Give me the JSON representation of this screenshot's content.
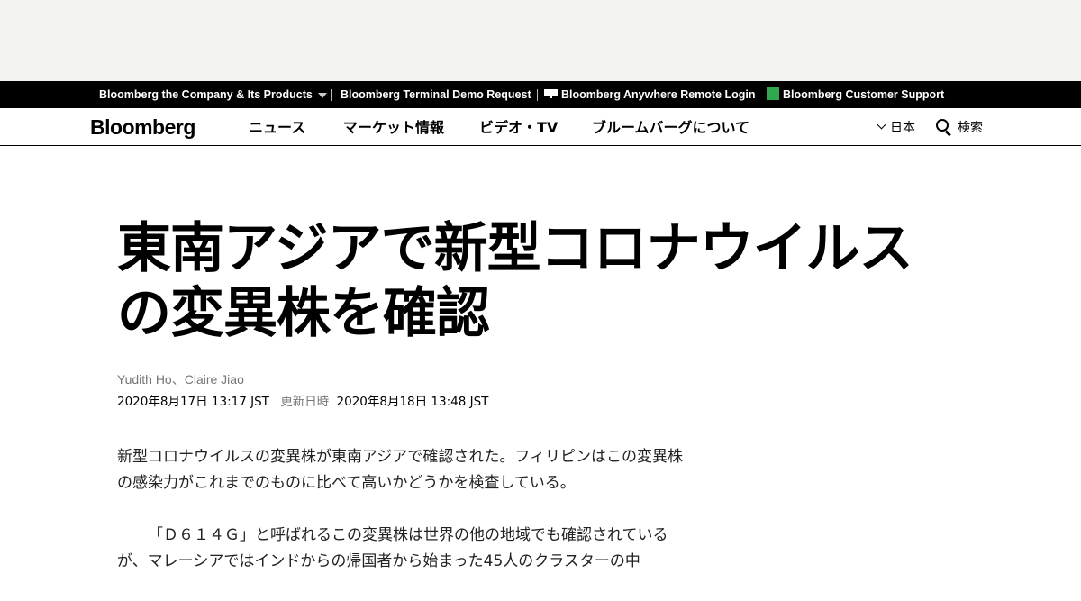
{
  "topbar": {
    "company_products": "Bloomberg the Company & Its Products",
    "terminal_demo": "Bloomberg Terminal Demo Request",
    "anywhere_login": "Bloomberg Anywhere Remote Login",
    "customer_support": "Bloomberg Customer Support",
    "accent_color": "#fb8b1e",
    "support_icon_color": "#2fa84f"
  },
  "nav": {
    "logo": "Bloomberg",
    "items": [
      "ニュース",
      "マーケット情報",
      "ビデオ・TV",
      "ブルームバーグについて"
    ],
    "language": "日本",
    "search_label": "検索"
  },
  "article": {
    "headline_line1": "東南アジアで新型コロナウイルス",
    "headline_line2": "の変異株を確認",
    "authors": [
      "Yudith Ho",
      "Claire Jiao"
    ],
    "author_separator": "、",
    "published": "2020年8月17日 13:17 JST",
    "updated_label": "更新日時",
    "updated": "2020年8月18日 13:48 JST",
    "paragraphs": [
      "新型コロナウイルスの変異株が東南アジアで確認された。フィリピンはこの変異株の感染力がこれまでのものに比べて高いかどうかを検査している。",
      "「Ｄ６１４Ｇ」と呼ばれるこの変異株は世界の他の地域でも確認されているが、マレーシアではインドからの帰国者から始まった45人のクラスターの中"
    ]
  }
}
